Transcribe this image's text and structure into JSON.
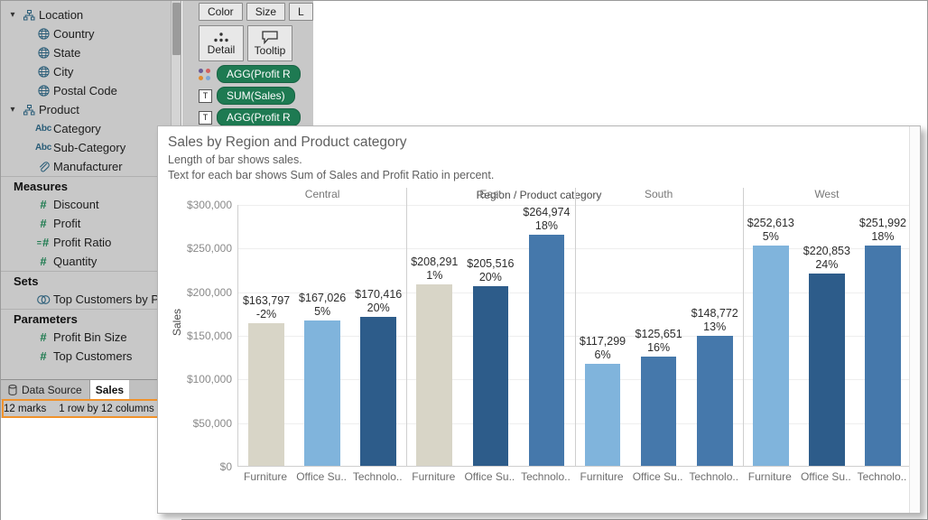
{
  "data_pane": {
    "groups": [
      {
        "label": "Location",
        "icon": "hierarchy-icon",
        "expanded": true,
        "children": [
          {
            "label": "Country",
            "icon": "globe-icon"
          },
          {
            "label": "State",
            "icon": "globe-icon"
          },
          {
            "label": "City",
            "icon": "globe-icon"
          },
          {
            "label": "Postal Code",
            "icon": "globe-icon"
          }
        ]
      },
      {
        "label": "Product",
        "icon": "hierarchy-icon",
        "expanded": true,
        "children": [
          {
            "label": "Category",
            "icon": "abc-icon"
          },
          {
            "label": "Sub-Category",
            "icon": "abc-icon"
          },
          {
            "label": "Manufacturer",
            "icon": "paperclip-icon"
          }
        ]
      }
    ],
    "sections": [
      {
        "header": "Measures",
        "items": [
          {
            "label": "Discount",
            "icon": "number-icon"
          },
          {
            "label": "Profit",
            "icon": "number-icon"
          },
          {
            "label": "Profit Ratio",
            "icon": "calculated-number-icon"
          },
          {
            "label": "Quantity",
            "icon": "number-icon"
          }
        ]
      },
      {
        "header": "Sets",
        "items": [
          {
            "label": "Top Customers by Prof",
            "icon": "set-icon"
          }
        ]
      },
      {
        "header": "Parameters",
        "items": [
          {
            "label": "Profit Bin Size",
            "icon": "number-icon"
          },
          {
            "label": "Top Customers",
            "icon": "number-icon"
          }
        ]
      }
    ]
  },
  "marks_card": {
    "buttons": [
      {
        "label": "Color",
        "icon": "color-icon"
      },
      {
        "label": "Size",
        "icon": "size-icon"
      },
      {
        "label": "L",
        "icon": "label-icon"
      }
    ],
    "big_buttons": [
      {
        "label": "Detail",
        "icon": "detail-icon"
      },
      {
        "label": "Tooltip",
        "icon": "tooltip-icon"
      }
    ],
    "pills": [
      {
        "label": "AGG(Profit R",
        "icon": "color-dots-icon"
      },
      {
        "label": "SUM(Sales)",
        "icon": "text-icon"
      },
      {
        "label": "AGG(Profit R",
        "icon": "text-icon"
      }
    ]
  },
  "tabs": {
    "data_source_label": "Data Source",
    "data_source_icon": "database-icon",
    "sheet_label": "Sales"
  },
  "status_bar": {
    "marks": "12 marks",
    "rows_cols": "1 row by 12 columns",
    "highlight_color": "#f0922b"
  },
  "viz": {
    "title": "Sales by Region and Product category",
    "subtitle_1": "Length of bar shows sales.",
    "subtitle_2": "Text for each bar shows Sum of Sales and Profit Ratio in percent."
  },
  "colors": {
    "beige": "#d8d5c7",
    "light_blue": "#80b4dc",
    "medium_blue": "#4578ab",
    "dark_blue": "#2d5c8a"
  },
  "chart_data": {
    "type": "bar",
    "title": "Sales by Region and Product category",
    "column_field_label": "Region / Product category",
    "ylabel": "Sales",
    "xlabel": "",
    "ylim": [
      0,
      300000
    ],
    "ytick_labels": [
      "$0",
      "$50,000",
      "$100,000",
      "$150,000",
      "$200,000",
      "$250,000",
      "$300,000"
    ],
    "ytick_values": [
      0,
      50000,
      100000,
      150000,
      200000,
      250000,
      300000
    ],
    "grid": true,
    "legend": "none",
    "categories": [
      "Furniture",
      "Office Su..",
      "Technolo.."
    ],
    "groups": [
      {
        "region": "Central",
        "bars": [
          {
            "category": "Furniture",
            "sales": 163797,
            "sales_label": "$163,797",
            "profit_ratio": -2,
            "profit_ratio_label": "-2%",
            "color": "#d8d5c7"
          },
          {
            "category": "Office Su..",
            "sales": 167026,
            "sales_label": "$167,026",
            "profit_ratio": 5,
            "profit_ratio_label": "5%",
            "color": "#80b4dc"
          },
          {
            "category": "Technolo..",
            "sales": 170416,
            "sales_label": "$170,416",
            "profit_ratio": 20,
            "profit_ratio_label": "20%",
            "color": "#2d5c8a"
          }
        ]
      },
      {
        "region": "East",
        "bars": [
          {
            "category": "Furniture",
            "sales": 208291,
            "sales_label": "$208,291",
            "profit_ratio": 1,
            "profit_ratio_label": "1%",
            "color": "#d8d5c7"
          },
          {
            "category": "Office Su..",
            "sales": 205516,
            "sales_label": "$205,516",
            "profit_ratio": 20,
            "profit_ratio_label": "20%",
            "color": "#2d5c8a"
          },
          {
            "category": "Technolo..",
            "sales": 264974,
            "sales_label": "$264,974",
            "profit_ratio": 18,
            "profit_ratio_label": "18%",
            "color": "#4578ab"
          }
        ]
      },
      {
        "region": "South",
        "bars": [
          {
            "category": "Furniture",
            "sales": 117299,
            "sales_label": "$117,299",
            "profit_ratio": 6,
            "profit_ratio_label": "6%",
            "color": "#80b4dc"
          },
          {
            "category": "Office Su..",
            "sales": 125651,
            "sales_label": "$125,651",
            "profit_ratio": 16,
            "profit_ratio_label": "16%",
            "color": "#4578ab"
          },
          {
            "category": "Technolo..",
            "sales": 148772,
            "sales_label": "$148,772",
            "profit_ratio": 13,
            "profit_ratio_label": "13%",
            "color": "#4578ab"
          }
        ]
      },
      {
        "region": "West",
        "bars": [
          {
            "category": "Furniture",
            "sales": 252613,
            "sales_label": "$252,613",
            "profit_ratio": 5,
            "profit_ratio_label": "5%",
            "color": "#80b4dc"
          },
          {
            "category": "Office Su..",
            "sales": 220853,
            "sales_label": "$220,853",
            "profit_ratio": 24,
            "profit_ratio_label": "24%",
            "color": "#2d5c8a"
          },
          {
            "category": "Technolo..",
            "sales": 251992,
            "sales_label": "$251,992",
            "profit_ratio": 18,
            "profit_ratio_label": "18%",
            "color": "#4578ab"
          }
        ]
      }
    ]
  }
}
